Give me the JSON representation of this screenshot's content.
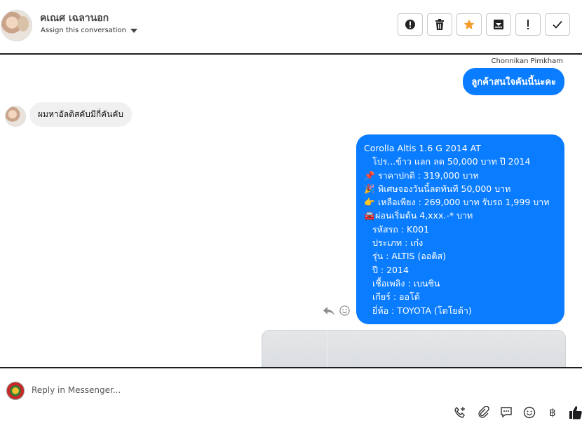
{
  "header": {
    "contact_name": "คเณศ เฉลานอก",
    "assign_label": "Assign this conversation",
    "actions": [
      "spam-report",
      "delete",
      "star",
      "archive",
      "mark-important",
      "mark-done"
    ]
  },
  "conversation": {
    "sender_name": "Chonnikan Pimkham",
    "messages": [
      {
        "direction": "out",
        "text": "ลูกค้าสนใจคันนี้นะคะ"
      },
      {
        "direction": "in",
        "text": "ผมหาอัลติสคับมีกี่คันคับ"
      },
      {
        "direction": "out",
        "lines": [
          "Corolla Altis 1.6 G 2014 AT",
          "โปร...ข้าว แลก ลด 50,000 บาท ปี 2014",
          "ราคาปกติ : 319,000 บาท",
          "พิเศษจองวันนี้ลดทันที 50,000 บาท",
          "เหลือเพียง : 269,000 บาท รับรถ 1,999 บาท",
          "ผ่อนเริ่มต้น 4,xxx.-* บาท",
          "รหัสรถ : K001",
          "ประเภท : เก๋ง",
          "รุ่น : ALTIS (ออติส)",
          "ปี : 2014",
          "เชื้อเพลิง : เบนซิน",
          "เกียร์ : ออโต้",
          "ยี่ห้อ : TOYOTA (โตโยต้า)"
        ]
      }
    ]
  },
  "reply": {
    "placeholder": "Reply in Messenger...",
    "tools": [
      "call-add-icon",
      "attachment-icon",
      "saved-reply-icon",
      "emoji-icon",
      "baht-icon",
      "thumbs-up-icon"
    ]
  },
  "colors": {
    "bubble_out": "#0a7cff",
    "bubble_in": "#f0f0f0",
    "star": "#f39c2b"
  }
}
